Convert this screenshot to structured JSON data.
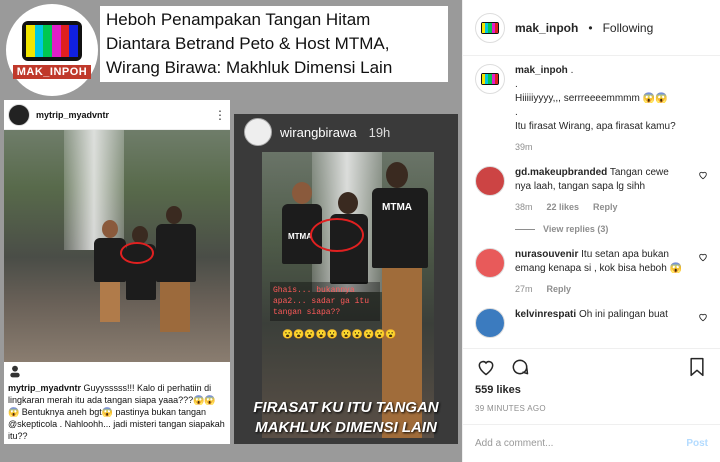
{
  "image": {
    "logo_text": "MAK_INPOH",
    "headline_lines": [
      "Heboh Penampakan Tangan Hitam",
      "Diantara Betrand Peto & Host MTMA,",
      "Wirang Birawa: Makhluk Dimensi Lain"
    ],
    "left_panel": {
      "avatar_text": "",
      "username": "mytrip_myadvntr",
      "caption_user": "mytrip_myadvntr",
      "caption_text": " Guyysssss!!! Kalo di perhatiin di lingkaran merah itu ada tangan siapa yaaa???😱😱😱 Bentuknya aneh bgt😱 pastinya bukan tangan @skepticola . Nahloohh... jadi misteri tangan siapakah itu??"
    },
    "right_panel": {
      "username": "wirangbirawa",
      "time": "19h",
      "shirt_text": "MTMA",
      "story_text": "Ghais... bukannya apa2... sadar ga itu tangan siapa??",
      "emoji_row": "😮😮😮😮😮 😮😮😮😮😮",
      "bottom_text_1": "FIRASAT KU ITU TANGAN",
      "bottom_text_2": "MAKHLUK DIMENSI LAIN"
    }
  },
  "header": {
    "username": "mak_inpoh",
    "separator": "•",
    "follow_status": "Following"
  },
  "caption": {
    "username": "mak_inpoh",
    "lines": [
      ".",
      ".",
      "Hiiiiiyyyy,,, serrreeeemmmm 😱😱",
      ".",
      "Itu firasat Wirang, apa firasat kamu?"
    ],
    "time": "39m"
  },
  "comments": [
    {
      "username": "gd.makeupbranded",
      "text": "Tangan cewe nya laah, tangan sapa lg sihh",
      "time": "38m",
      "likes": "22 likes",
      "reply_label": "Reply",
      "view_replies": "View replies (3)"
    },
    {
      "username": "nurasouvenir",
      "text": "Itu setan apa bukan emang kenapa si , kok bisa heboh 😱",
      "time": "27m",
      "reply_label": "Reply"
    },
    {
      "username": "kelvinrespati",
      "text": "Oh ini palingan buat"
    }
  ],
  "likes": "559 likes",
  "posted_ago": "39 MINUTES AGO",
  "add_comment": {
    "placeholder": "Add a comment...",
    "post_label": "Post"
  },
  "colors": {
    "accent_blue": "#b3dbff",
    "text_primary": "#262626",
    "text_secondary": "#8e8e8e",
    "circle_red": "#e02020"
  },
  "icons": [
    "heart-icon",
    "comment-icon",
    "bookmark-icon",
    "more-icon"
  ]
}
